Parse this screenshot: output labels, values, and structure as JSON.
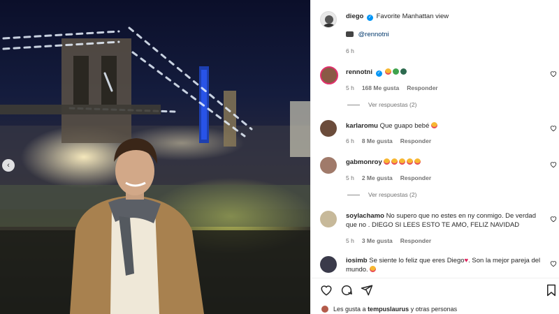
{
  "post": {
    "author": "diego",
    "caption": "Favorite Manhattan view",
    "photo_credit": "@rennotni",
    "time": "6 h"
  },
  "comments": [
    {
      "user": "rennotni",
      "verified": true,
      "text": "",
      "emoji_count": 3,
      "time": "5 h",
      "likes": "168 Me gusta",
      "reply": "Responder",
      "replies": "Ver respuestas (2)"
    },
    {
      "user": "karlaromu",
      "text": "Que guapo bebé",
      "emoji_count": 1,
      "time": "6 h",
      "likes": "8 Me gusta",
      "reply": "Responder"
    },
    {
      "user": "gabmonroy",
      "text": "",
      "emoji_count": 5,
      "time": "5 h",
      "likes": "2 Me gusta",
      "reply": "Responder",
      "replies": "Ver respuestas (2)"
    },
    {
      "user": "soylachamo",
      "text": "No supero que no estes en ny conmigo. De verdad que no . DIEGO SI LEES ESTO TE AMO, FELIZ NAVIDAD",
      "time": "5 h",
      "likes": "3 Me gusta",
      "reply": "Responder"
    },
    {
      "user": "iosimb",
      "text": "Se siente lo feliz que eres Diego",
      "text2": ". Son la mejor pareja del mundo.",
      "emoji_count": 1
    }
  ],
  "likes_line": {
    "prefix": "Les gusta a",
    "user": "tempuslaurus",
    "suffix": "y otras personas"
  },
  "icons": [
    "heart-icon",
    "comment-icon",
    "share-icon",
    "bookmark-icon",
    "camera-icon",
    "verified-badge-icon",
    "chevron-left-icon"
  ],
  "colors": {
    "verified": "#0095f6",
    "meta": "#737373",
    "text": "#262626"
  }
}
